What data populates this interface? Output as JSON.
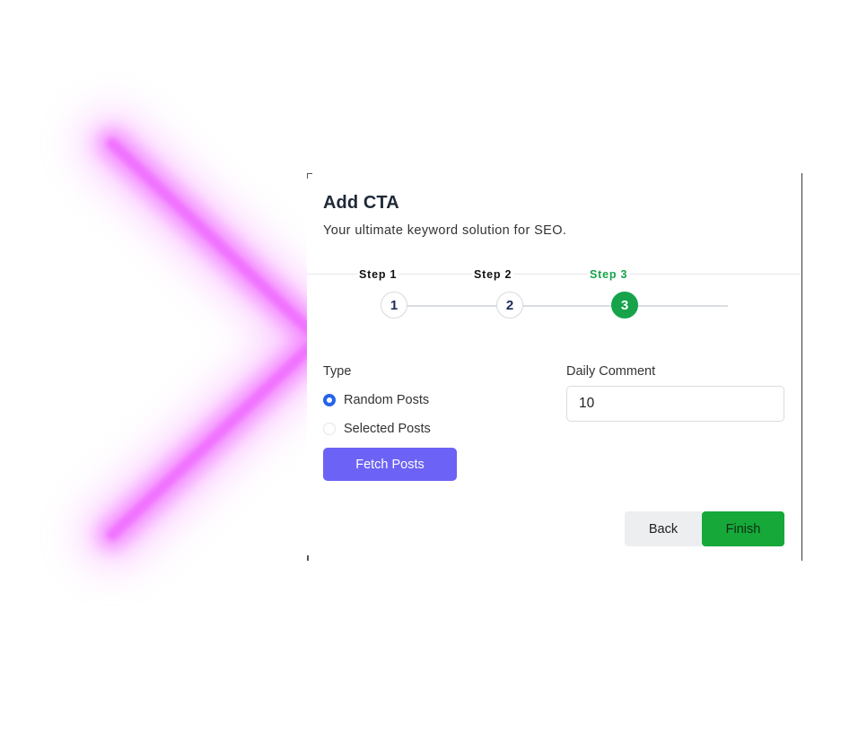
{
  "modal": {
    "title": "Add CTA",
    "subtitle": "Your ultimate keyword solution for SEO."
  },
  "stepper": {
    "steps": [
      {
        "label": "Step 1",
        "number": "1",
        "state": "inactive"
      },
      {
        "label": "Step 2",
        "number": "2",
        "state": "inactive"
      },
      {
        "label": "Step 3",
        "number": "3",
        "state": "active"
      }
    ],
    "current_step": 3
  },
  "form": {
    "type_label": "Type",
    "type_options": [
      {
        "label": "Random Posts",
        "checked": true
      },
      {
        "label": "Selected Posts",
        "checked": false
      }
    ],
    "fetch_label": "Fetch Posts",
    "daily_comment_label": "Daily Comment",
    "daily_comment_value": "10"
  },
  "footer": {
    "back_label": "Back",
    "finish_label": "Finish"
  },
  "colors": {
    "accent_green": "#16a34a",
    "fetch_purple": "#6c63f6",
    "radio_blue": "#2563eb",
    "glow_magenta": "#ee44ff"
  }
}
